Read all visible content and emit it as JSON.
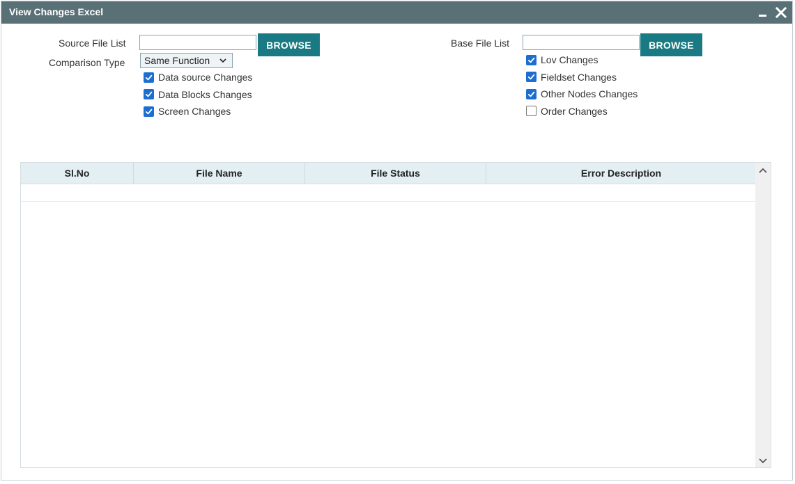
{
  "window": {
    "title": "View Changes Excel"
  },
  "form": {
    "source_file_label": "Source File List",
    "source_file_value": "",
    "browse_label": "BROWSE",
    "base_file_label": "Base File List",
    "base_file_value": "",
    "comparison_type_label": "Comparison Type",
    "comparison_type_value": "Same Function",
    "left_checks": [
      {
        "label": "Data source Changes",
        "checked": true
      },
      {
        "label": "Data Blocks Changes",
        "checked": true
      },
      {
        "label": "Screen Changes",
        "checked": true
      }
    ],
    "right_checks": [
      {
        "label": "Lov Changes",
        "checked": true
      },
      {
        "label": "Fieldset Changes",
        "checked": true
      },
      {
        "label": "Other Nodes Changes",
        "checked": true
      },
      {
        "label": "Order Changes",
        "checked": false
      }
    ]
  },
  "table": {
    "columns": [
      "Sl.No",
      "File Name",
      "File Status",
      "Error Description"
    ],
    "rows": []
  },
  "icons": {
    "minimize": "minimize-icon",
    "close": "close-icon",
    "dropdown": "chevron-down-icon",
    "scroll_up": "chevron-up-icon",
    "scroll_down": "chevron-down-icon"
  },
  "colors": {
    "titlebar": "#5a7077",
    "button": "#1a7a83",
    "checkbox": "#1c6fd1",
    "table_header": "#e4eff3"
  }
}
